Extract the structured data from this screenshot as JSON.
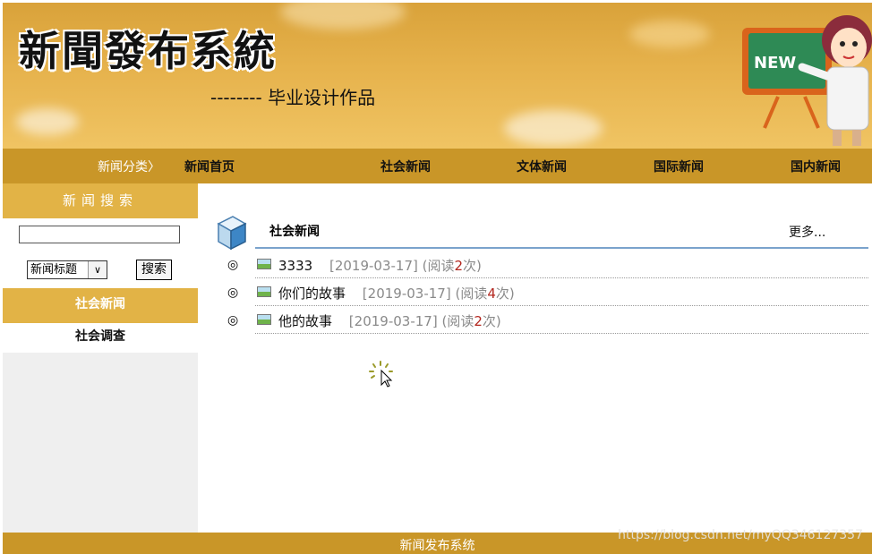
{
  "header": {
    "site_title": "新聞發布系統",
    "subtitle": "-------- 毕业设计作品",
    "badge": "NEW"
  },
  "nav": {
    "category_label": "新闻分类〉",
    "items": [
      "新闻首页",
      "社会新闻",
      "文体新闻",
      "国际新闻",
      "国内新闻"
    ]
  },
  "sidebar": {
    "search_heading": "新闻搜索",
    "search_input_value": "",
    "select_value": "新闻标题",
    "search_button": "搜索",
    "category_heading": "社会新闻",
    "items": [
      "社会调查"
    ]
  },
  "main": {
    "section_title": "社会新闻",
    "more_label": "更多...",
    "news": [
      {
        "title": "3333",
        "date": "[2019-03-17]",
        "read_prefix": "(阅读",
        "reads": "2",
        "read_suffix": "次)"
      },
      {
        "title": "你们的故事",
        "date": "[2019-03-17]",
        "read_prefix": "(阅读",
        "reads": "4",
        "read_suffix": "次)"
      },
      {
        "title": "他的故事",
        "date": "[2019-03-17]",
        "read_prefix": "(阅读",
        "reads": "2",
        "read_suffix": "次)"
      }
    ]
  },
  "footer": {
    "text": "新闻发布系统",
    "watermark": "https://blog.csdn.net/myQQ346127357"
  },
  "icons": {
    "bullet": "◎",
    "dropdown": "∨"
  },
  "colors": {
    "banner": "#e6b24c",
    "nav": "#c99628",
    "sidebar_head": "#e2b346",
    "accent_line": "#7aa3cc",
    "read_count": "#b3261e"
  }
}
